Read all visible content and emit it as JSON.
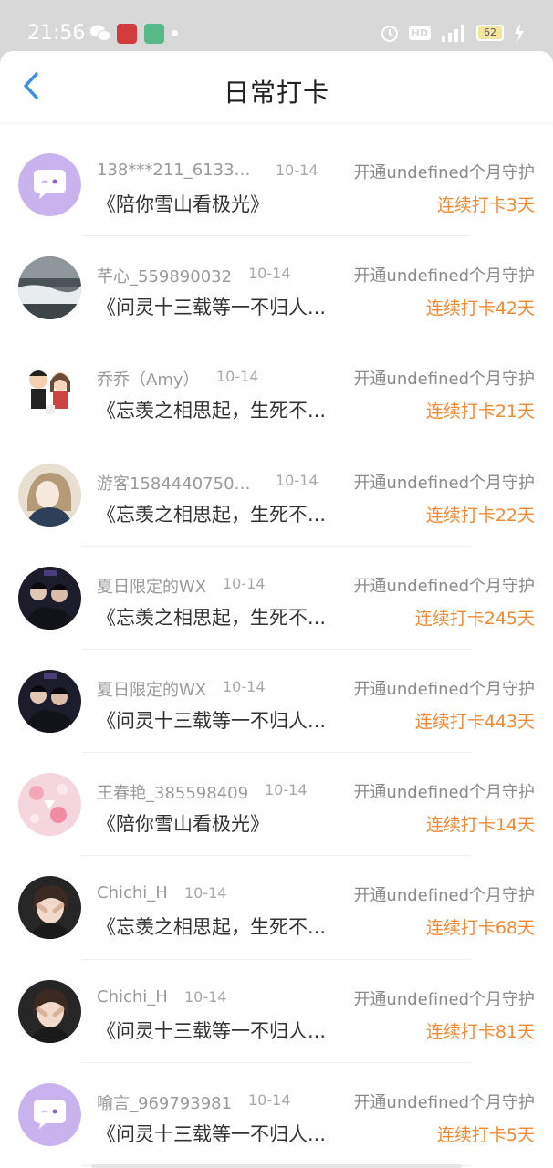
{
  "status_bar": {
    "time": "21:56",
    "hd": "HD",
    "battery": "62",
    "icons": [
      "wechat-icon",
      "app-icon-red",
      "app-icon-green",
      "dot-icon",
      "alarm-icon",
      "hd-badge",
      "signal-icon",
      "battery-icon",
      "bolt-icon"
    ]
  },
  "header": {
    "title": "日常打卡",
    "back_icon": "chevron-left-icon",
    "accent_color": "#3a8ee6"
  },
  "colors": {
    "streak": "#f08a36",
    "name": "#9a9a9a",
    "guard": "#8a8a8a"
  },
  "rows": [
    {
      "name": "138***211_61333...",
      "date": "10-14",
      "guard": "开通undefined个月守护",
      "song": "《陪你雪山看极光》",
      "streak": "连续打卡3天",
      "avatar": "chat-bubble-avatar"
    },
    {
      "name": "芊心_559890032",
      "date": "10-14",
      "guard": "开通undefined个月守护",
      "song": "《问灵十三载等一不归人...",
      "streak": "连续打卡42天",
      "avatar": "waterfall-photo-avatar"
    },
    {
      "name": "乔乔（Amy）",
      "date": "10-14",
      "guard": "开通undefined个月守护",
      "song": "《忘羡之相思起，生死不...",
      "streak": "连续打卡21天",
      "avatar": "cartoon-couple-avatar"
    },
    {
      "name": "游客15844407500...",
      "date": "10-14",
      "guard": "开通undefined个月守护",
      "song": "《忘羡之相思起，生死不...",
      "streak": "连续打卡22天",
      "avatar": "girl-drawing-avatar"
    },
    {
      "name": "夏日限定的WX",
      "date": "10-14",
      "guard": "开通undefined个月守护",
      "song": "《忘羡之相思起，生死不...",
      "streak": "连续打卡245天",
      "avatar": "two-men-photo-avatar"
    },
    {
      "name": "夏日限定的WX",
      "date": "10-14",
      "guard": "开通undefined个月守护",
      "song": "《问灵十三载等一不归人...",
      "streak": "连续打卡443天",
      "avatar": "two-men-photo-avatar"
    },
    {
      "name": "王春艳_385598409",
      "date": "10-14",
      "guard": "开通undefined个月守护",
      "song": "《陪你雪山看极光》",
      "streak": "连续打卡14天",
      "avatar": "pink-pattern-avatar"
    },
    {
      "name": "Chichi_H",
      "date": "10-14",
      "guard": "开通undefined个月守护",
      "song": "《忘羡之相思起，生死不...",
      "streak": "连续打卡68天",
      "avatar": "girl-face-cover-avatar"
    },
    {
      "name": "Chichi_H",
      "date": "10-14",
      "guard": "开通undefined个月守护",
      "song": "《问灵十三载等一不归人...",
      "streak": "连续打卡81天",
      "avatar": "girl-face-cover-avatar"
    },
    {
      "name": "喻言_969793981",
      "date": "10-14",
      "guard": "开通undefined个月守护",
      "song": "《问灵十三载等一不归人...",
      "streak": "连续打卡5天",
      "avatar": "chat-bubble-avatar"
    }
  ]
}
